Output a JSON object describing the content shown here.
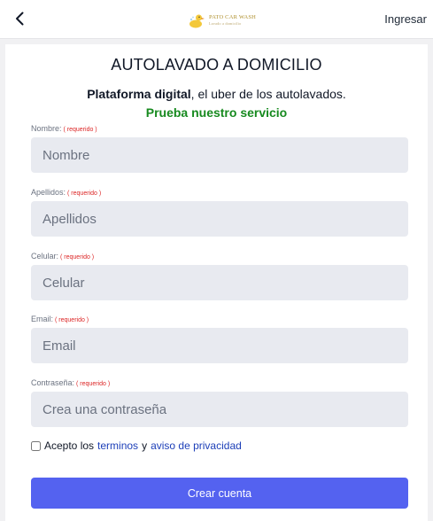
{
  "header": {
    "logo_name": "PATO CAR WASH",
    "logo_tagline": "Lavado a domicilio",
    "login_label": "Ingresar",
    "back_icon": "chevron-left-icon"
  },
  "main": {
    "title": "AUTOLAVADO A DOMICILIO",
    "subtitle_bold": "Plataforma digital",
    "subtitle_rest": ", el uber de los autolavados.",
    "cta": "Prueba nuestro servicio"
  },
  "form": {
    "required_tag": "( requerido )",
    "fields": [
      {
        "label": "Nombre:",
        "placeholder": "Nombre"
      },
      {
        "label": "Apellidos:",
        "placeholder": "Apellidos"
      },
      {
        "label": "Celular:",
        "placeholder": "Celular"
      },
      {
        "label": "Email:",
        "placeholder": "Email"
      },
      {
        "label": "Contraseña:",
        "placeholder": "Crea una contraseña"
      }
    ],
    "terms_prefix": "Acepto los",
    "terms_link": "terminos",
    "terms_and": "y",
    "privacy_link": "aviso de privacidad",
    "submit_label": "Crear cuenta"
  },
  "colors": {
    "accent": "#5462f0",
    "cta_green": "#178a1f",
    "required_red": "#dc2626",
    "link_blue": "#1d3fb8",
    "input_bg": "#e8eaf0"
  }
}
